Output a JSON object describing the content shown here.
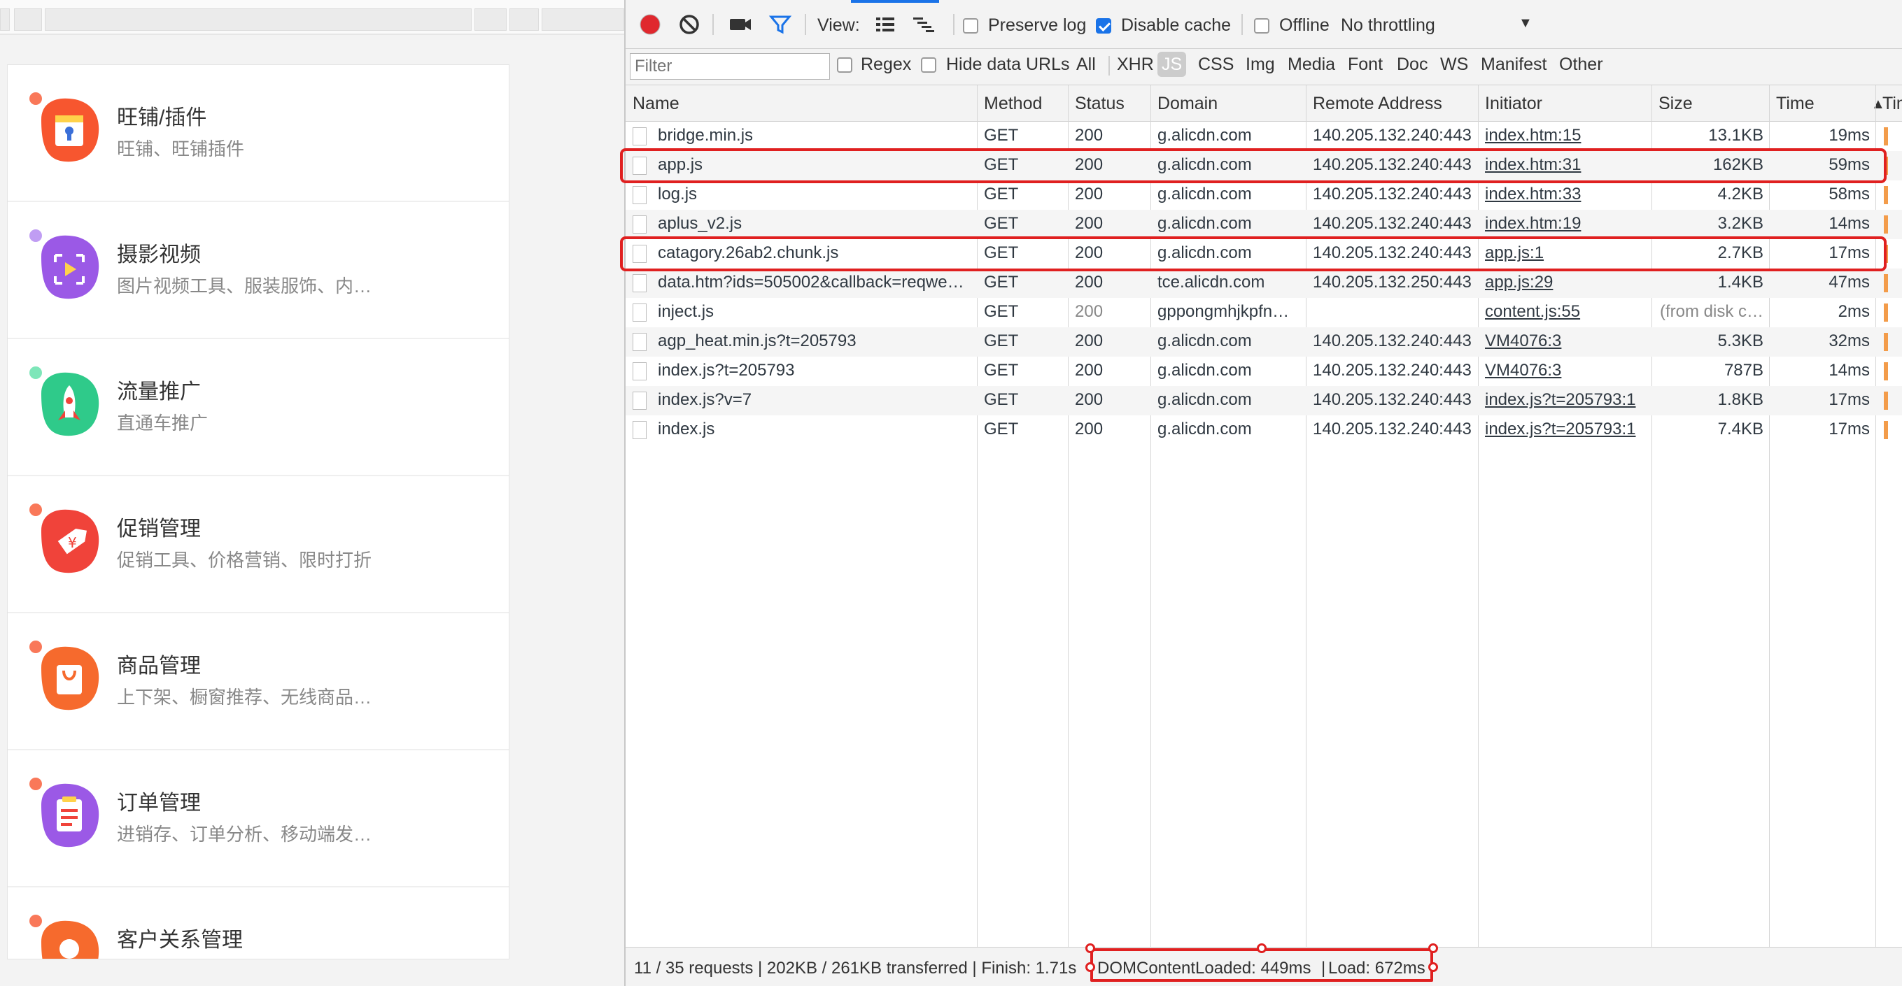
{
  "left_page": {
    "cards": [
      {
        "title": "旺铺/插件",
        "subtitle": "旺铺、旺铺插件",
        "icon": "shop-icon",
        "color": "#f7562f"
      },
      {
        "title": "摄影视频",
        "subtitle": "图片视频工具、服装服饰、内…",
        "icon": "camera-video-icon",
        "color": "#9b59e6"
      },
      {
        "title": "流量推广",
        "subtitle": "直通车推广",
        "icon": "rocket-icon",
        "color": "#2fca8a"
      },
      {
        "title": "促销管理",
        "subtitle": "促销工具、价格营销、限时打折",
        "icon": "price-tag-icon",
        "color": "#f0433a"
      },
      {
        "title": "商品管理",
        "subtitle": "上下架、橱窗推荐、无线商品…",
        "icon": "shopping-bag-icon",
        "color": "#f66a2d"
      },
      {
        "title": "订单管理",
        "subtitle": "进销存、订单分析、移动端发…",
        "icon": "clipboard-icon",
        "color": "#9b59e6"
      },
      {
        "title": "客户关系管理",
        "subtitle": "",
        "icon": "customer-icon",
        "color": "#f7562f"
      }
    ]
  },
  "devtools": {
    "toolbar": {
      "view_label": "View:",
      "preserve_log": "Preserve log",
      "disable_cache": "Disable cache",
      "offline": "Offline",
      "throttling": "No throttling",
      "disable_cache_checked": true
    },
    "filter_bar": {
      "placeholder": "Filter",
      "regex": "Regex",
      "hide_data_urls": "Hide data URLs",
      "types": [
        "All",
        "XHR",
        "JS",
        "CSS",
        "Img",
        "Media",
        "Font",
        "Doc",
        "WS",
        "Manifest",
        "Other"
      ],
      "active_type": "JS"
    },
    "columns": [
      "Name",
      "Method",
      "Status",
      "Domain",
      "Remote Address",
      "Initiator",
      "Size",
      "Time",
      "Tim"
    ],
    "rows": [
      {
        "name": "bridge.min.js",
        "method": "GET",
        "status": "200",
        "domain": "g.alicdn.com",
        "remote": "140.205.132.240:443",
        "initiator": "index.htm:15",
        "size": "13.1KB",
        "time": "19ms"
      },
      {
        "name": "app.js",
        "method": "GET",
        "status": "200",
        "domain": "g.alicdn.com",
        "remote": "140.205.132.240:443",
        "initiator": "index.htm:31",
        "size": "162KB",
        "time": "59ms"
      },
      {
        "name": "log.js",
        "method": "GET",
        "status": "200",
        "domain": "g.alicdn.com",
        "remote": "140.205.132.240:443",
        "initiator": "index.htm:33",
        "size": "4.2KB",
        "time": "58ms"
      },
      {
        "name": "aplus_v2.js",
        "method": "GET",
        "status": "200",
        "domain": "g.alicdn.com",
        "remote": "140.205.132.240:443",
        "initiator": "index.htm:19",
        "size": "3.2KB",
        "time": "14ms"
      },
      {
        "name": "catagory.26ab2.chunk.js",
        "method": "GET",
        "status": "200",
        "domain": "g.alicdn.com",
        "remote": "140.205.132.240:443",
        "initiator": "app.js:1",
        "size": "2.7KB",
        "time": "17ms"
      },
      {
        "name": "data.htm?ids=505002&callback=reqwe…",
        "method": "GET",
        "status": "200",
        "domain": "tce.alicdn.com",
        "remote": "140.205.132.250:443",
        "initiator": "app.js:29",
        "size": "1.4KB",
        "time": "47ms"
      },
      {
        "name": "inject.js",
        "method": "GET",
        "status": "200",
        "domain": "gppongmhjkpfn…",
        "remote": "",
        "initiator": "content.js:55",
        "size": "(from disk c…",
        "time": "2ms"
      },
      {
        "name": "agp_heat.min.js?t=205793",
        "method": "GET",
        "status": "200",
        "domain": "g.alicdn.com",
        "remote": "140.205.132.240:443",
        "initiator": "VM4076:3",
        "size": "5.3KB",
        "time": "32ms"
      },
      {
        "name": "index.js?t=205793",
        "method": "GET",
        "status": "200",
        "domain": "g.alicdn.com",
        "remote": "140.205.132.240:443",
        "initiator": "VM4076:3",
        "size": "787B",
        "time": "14ms"
      },
      {
        "name": "index.js?v=7",
        "method": "GET",
        "status": "200",
        "domain": "g.alicdn.com",
        "remote": "140.205.132.240:443",
        "initiator": "index.js?t=205793:1",
        "size": "1.8KB",
        "time": "17ms"
      },
      {
        "name": "index.js",
        "method": "GET",
        "status": "200",
        "domain": "g.alicdn.com",
        "remote": "140.205.132.240:443",
        "initiator": "index.js?t=205793:1",
        "size": "7.4KB",
        "time": "17ms"
      }
    ],
    "status_bar": {
      "summary": "11 / 35 requests | 202KB / 261KB transferred | Finish: 1.71s",
      "dom_content_loaded": "DOMContentLoaded: 449ms",
      "load": "Load: 672ms"
    },
    "colors": {
      "highlight": "#e02020",
      "record": "#e0282e",
      "dcl": "#1a34d6",
      "load": "#d0271d",
      "active_filter": "#1a73e8"
    }
  }
}
